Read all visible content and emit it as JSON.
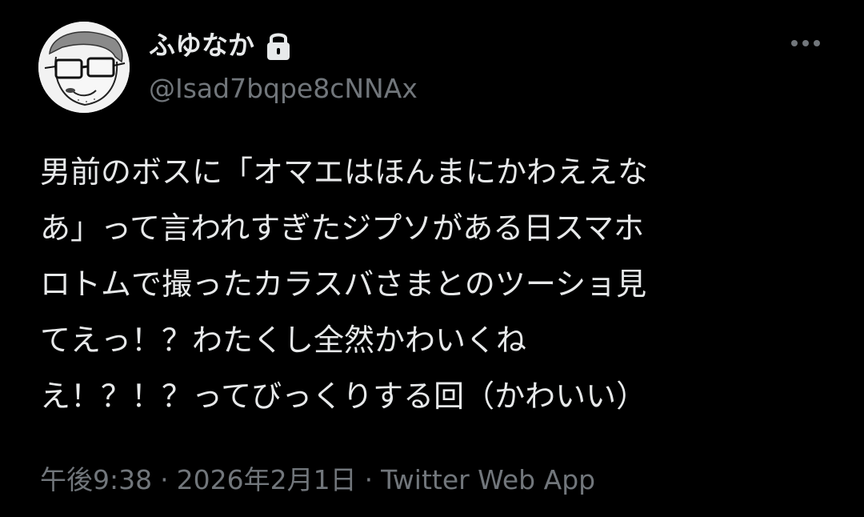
{
  "user": {
    "display_name": "ふゆなか",
    "handle": "@Isad7bqpe8cNNAx",
    "protected_icon": "lock-icon",
    "avatar_icon": "avatar-sketch-glasses"
  },
  "tweet": {
    "lines": [
      "男前のボスに「オマエはほんまにかわええな",
      "あ」って言われすぎたジプソがある日スマホ",
      "ロトムで撮ったカラスバさまとのツーショ見",
      "てえっ！？わたくし全然かわいくね",
      "え！？！？ってびっくりする回（かわいい）"
    ]
  },
  "meta": {
    "time": "午後9:38",
    "separator": "·",
    "date": "2026年2月1日",
    "source": "Twitter Web App"
  },
  "toolbar": {
    "more_icon": "more-horizontal-icon"
  },
  "colors": {
    "background": "#000000",
    "primary_text": "#e7e9ea",
    "secondary_text": "#71767b"
  }
}
